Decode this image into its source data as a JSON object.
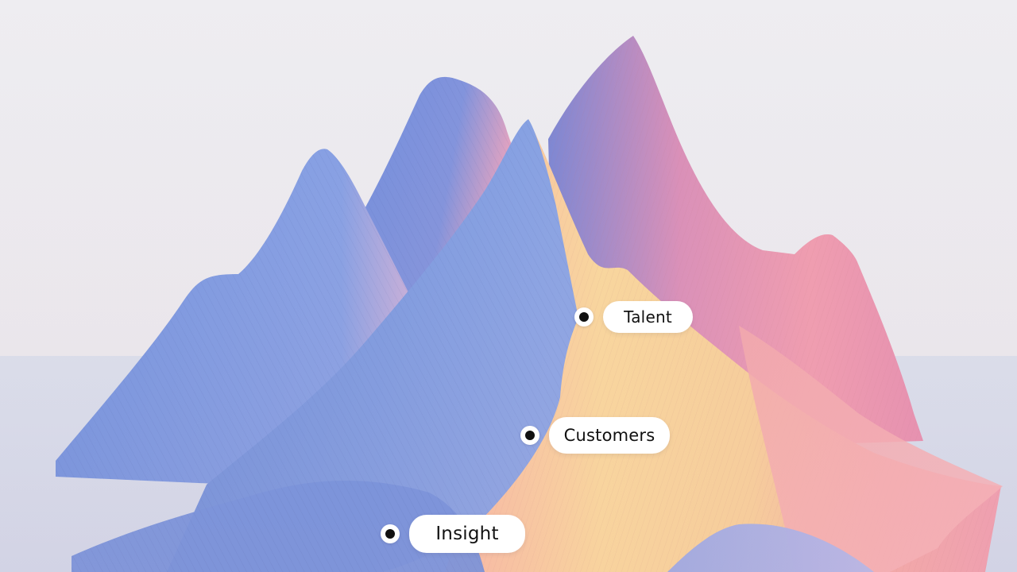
{
  "scene": {
    "description_icon": "layered-mountain-range-illustration",
    "colors": {
      "sky": "#eceaf0",
      "ground": "#d6dceb",
      "blue": "#6f8ddc",
      "pink": "#f0a0b4",
      "peach": "#f6c3a2",
      "yellow": "#f7dc95"
    }
  },
  "markers": {
    "talent": {
      "label": "Talent"
    },
    "customers": {
      "label": "Customers"
    },
    "insight": {
      "label": "Insight"
    }
  }
}
